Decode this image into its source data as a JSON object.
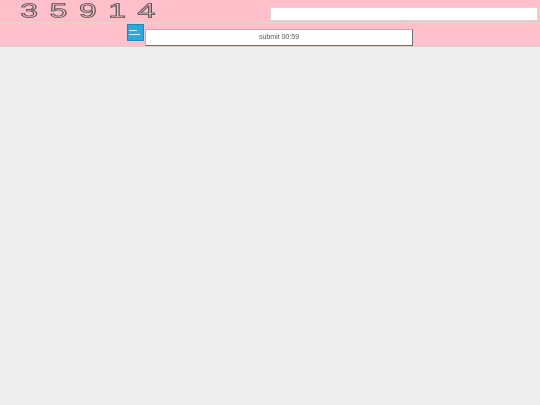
{
  "captcha": {
    "code": "35914",
    "input_value": "",
    "image_background": "#ffc0cb"
  },
  "submit": {
    "label": "submit 00:59",
    "thumbnail_icon": "image-thumbnail-icon",
    "thumbnail_color": "#2aa8e0"
  },
  "page": {
    "background": "#eeeeee",
    "row_background": "#ffc0cb"
  }
}
